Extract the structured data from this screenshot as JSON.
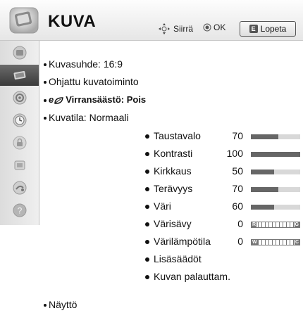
{
  "header": {
    "title": "KUVA",
    "hint_move": "Siirrä",
    "hint_ok": "OK",
    "exit_label": "Lopeta",
    "exit_key": "E"
  },
  "sidebar": {
    "items": [
      {
        "icon": "tv-picture-icon",
        "active": false
      },
      {
        "icon": "picture-screen-icon",
        "active": true
      },
      {
        "icon": "speaker-icon",
        "active": false
      },
      {
        "icon": "clock-icon",
        "active": false
      },
      {
        "icon": "lock-icon",
        "active": false
      },
      {
        "icon": "option-icon",
        "active": false
      },
      {
        "icon": "input-icon",
        "active": false
      },
      {
        "icon": "help-icon",
        "active": false
      }
    ]
  },
  "menu": {
    "aspect": "Kuvasuhde: 16:9",
    "guided": "Ohjattu kuvatoiminto",
    "energy_prefix": "e",
    "energy": "Virransäästö: Pois",
    "mode": "Kuvatila: Normaali",
    "display": "Näyttö"
  },
  "settings": [
    {
      "label": "Taustavalo",
      "value": "70",
      "type": "bar",
      "level": 0.55
    },
    {
      "label": "Kontrasti",
      "value": "100",
      "type": "bar",
      "level": 1.0
    },
    {
      "label": "Kirkkaus",
      "value": "50",
      "type": "bar",
      "level": 0.47
    },
    {
      "label": "Terävyys",
      "value": "70",
      "type": "bar",
      "level": 0.55
    },
    {
      "label": "Väri",
      "value": "60",
      "type": "bar",
      "level": 0.47
    },
    {
      "label": "Värisävy",
      "value": "0",
      "type": "balance",
      "left": "R",
      "right": "G"
    },
    {
      "label": "Värilämpötila",
      "value": "0",
      "type": "balance",
      "left": "W",
      "right": "C"
    },
    {
      "label": "Lisäsäädöt",
      "value": "",
      "type": "none"
    },
    {
      "label": "Kuvan palauttam.",
      "value": "",
      "type": "none"
    }
  ]
}
